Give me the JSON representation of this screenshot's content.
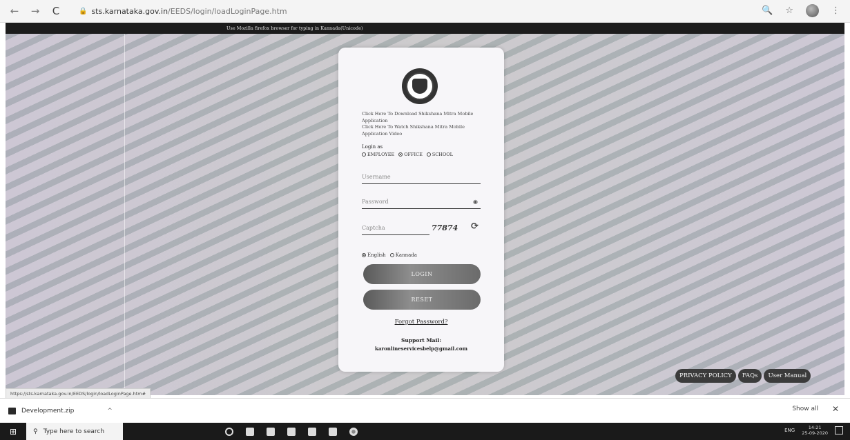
{
  "browser": {
    "url_domain": "sts.karnataka.gov.in",
    "url_path": "/EEDS/login/loadLoginPage.htm",
    "back_icon": "←",
    "forward_icon": "→",
    "reload_icon": "C",
    "lock_icon": "🔒",
    "zoom_icon": "🔍",
    "star_icon": "☆",
    "menu_icon": "⋮"
  },
  "notice_bar": {
    "text": "Use Mozilla firefox browser for typing in Kannada(Unicode)"
  },
  "login_card": {
    "links": [
      "Click Here To Download Shikshana Mitra Mobile Application",
      "Click Here To Watch Shikshana Mitra Mobile Application Video"
    ],
    "login_as_label": "Login as",
    "login_as_options": [
      {
        "label": "EMPLOYEE",
        "selected": false
      },
      {
        "label": "OFFICE",
        "selected": true
      },
      {
        "label": "SCHOOL",
        "selected": false
      }
    ],
    "username_placeholder": "Username",
    "password_placeholder": "Password",
    "captcha_placeholder": "Captcha",
    "captcha_code": "77874",
    "refresh_icon": "⟳",
    "eye_icon": "◉",
    "language_options": [
      {
        "label": "English",
        "selected": true
      },
      {
        "label": "Kannada",
        "selected": false
      }
    ],
    "login_button": "LOGIN",
    "reset_button": "RESET",
    "forgot_password": "Forgot Password?",
    "support_title": "Support Mail:",
    "support_email": "karonlineservicesbelp@gmail.com"
  },
  "footer_links": [
    "PRIVACY POLICY",
    "FAQs",
    "User Manual"
  ],
  "status_url": "https://sts.karnataka.gov.in/EEDS/login/loadLoginPage.htm#",
  "download_bar": {
    "file_name": "Development.zip",
    "chevron": "^",
    "show_all": "Show all",
    "close": "✕"
  },
  "taskbar": {
    "search_placeholder": "Type here to search",
    "windows_icon": "⊞",
    "search_icon": "⚲",
    "tray_lang": "ENG",
    "time": "14:21",
    "date": "25-09-2020"
  }
}
